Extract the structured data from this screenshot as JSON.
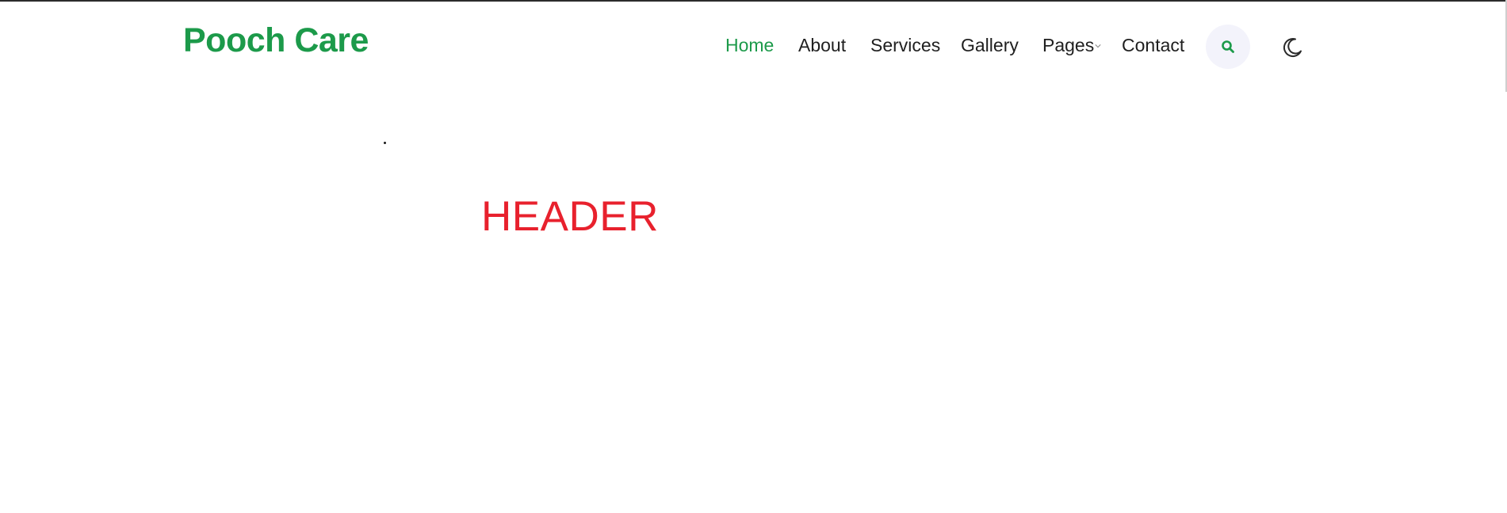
{
  "brand": {
    "name": "Pooch Care"
  },
  "nav": {
    "items": [
      {
        "label": "Home"
      },
      {
        "label": "About"
      },
      {
        "label": "Services"
      },
      {
        "label": "Gallery"
      },
      {
        "label": "Pages"
      },
      {
        "label": "Contact"
      }
    ],
    "search_icon": "search-icon",
    "theme_icon": "moon-icon",
    "dropdown_icon": "chevron-down-icon"
  },
  "content": {
    "header_text": "HEADER"
  },
  "colors": {
    "brand_green": "#1c9a4a",
    "nav_text": "#1f1f1f",
    "header_red": "#e8212d",
    "search_bg": "#f3f3fb"
  }
}
